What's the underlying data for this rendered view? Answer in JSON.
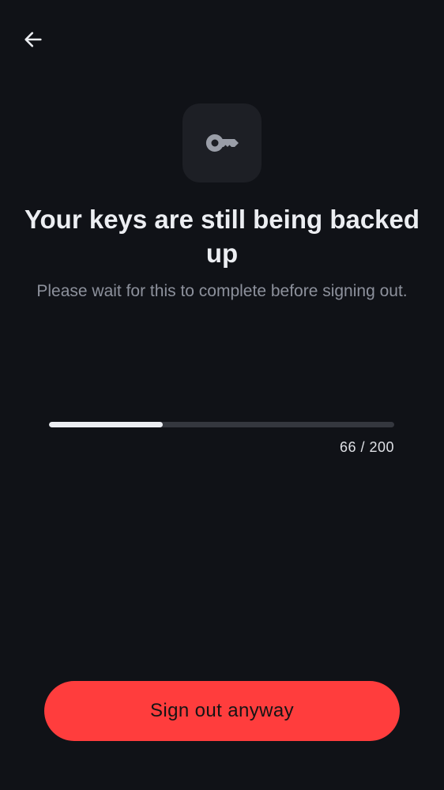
{
  "header": {
    "back_icon": "arrow-left-icon"
  },
  "hero": {
    "icon": "key-icon",
    "title": "Your keys are still being backed up",
    "subtitle": "Please wait for this to complete before signing out."
  },
  "progress": {
    "current": 66,
    "total": 200,
    "label": "66 / 200"
  },
  "actions": {
    "sign_out_label": "Sign out anyway"
  },
  "colors": {
    "background": "#101217",
    "tile": "#1d1f25",
    "text_primary": "#eceef2",
    "text_secondary": "#8d919c",
    "progress_track": "#34373e",
    "progress_fill": "#eceef2",
    "danger": "#ff3d3d"
  }
}
